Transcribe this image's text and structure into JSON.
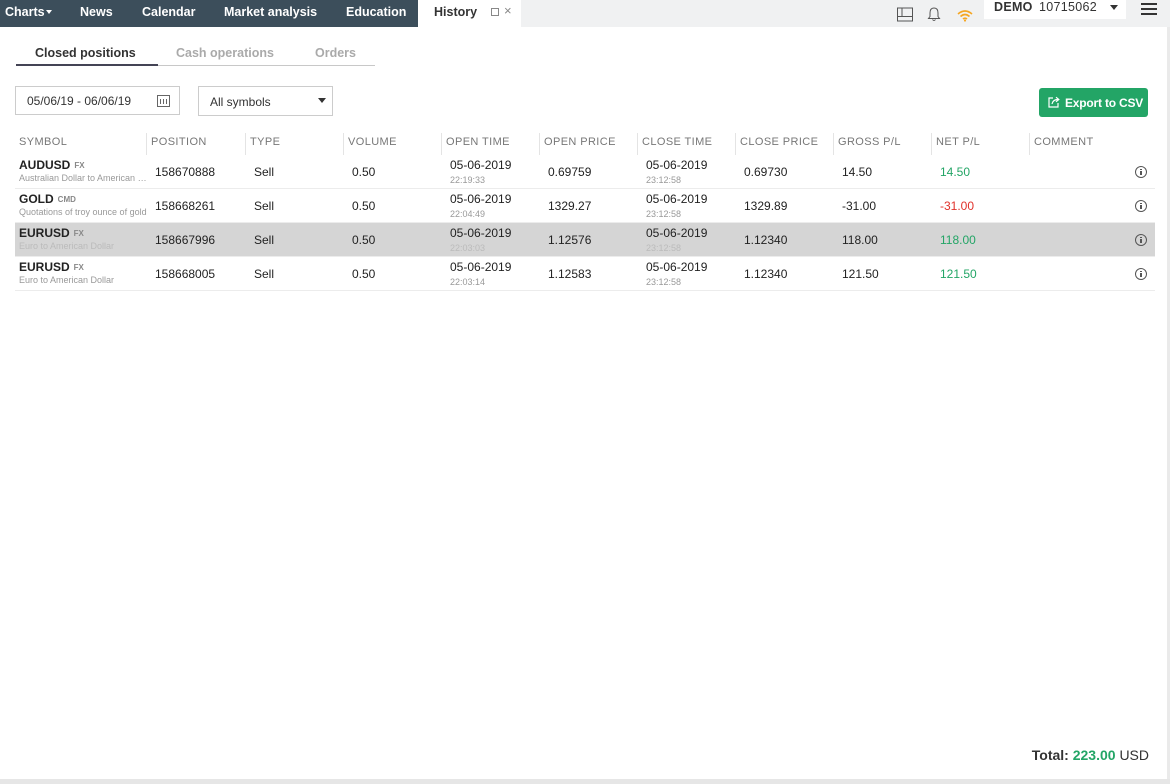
{
  "topnav": {
    "items": [
      "Charts",
      "News",
      "Calendar",
      "Market analysis",
      "Education"
    ],
    "active_tab": "History"
  },
  "account": {
    "mode": "DEMO",
    "number": "10715062"
  },
  "subtabs": [
    "Closed positions",
    "Cash operations",
    "Orders"
  ],
  "filters": {
    "date_range": "05/06/19 - 06/06/19",
    "symbols": "All symbols"
  },
  "export_label": "Export to CSV",
  "table": {
    "columns": [
      "SYMBOL",
      "POSITION",
      "TYPE",
      "VOLUME",
      "OPEN TIME",
      "OPEN PRICE",
      "CLOSE TIME",
      "CLOSE PRICE",
      "GROSS P/L",
      "NET P/L",
      "COMMENT"
    ],
    "rows": [
      {
        "symbol": "AUDUSD",
        "tag": "FX",
        "desc": "Australian Dollar to American Dollar",
        "position": "158670888",
        "type": "Sell",
        "volume": "0.50",
        "open_date": "05-06-2019",
        "open_time": "22:19:33",
        "open_price": "0.69759",
        "close_date": "05-06-2019",
        "close_time": "23:12:58",
        "close_price": "0.69730",
        "gross": "14.50",
        "net": "14.50",
        "net_sign": "pos",
        "comment": ""
      },
      {
        "symbol": "GOLD",
        "tag": "CMD",
        "desc": "Quotations of troy ounce of gold",
        "position": "158668261",
        "type": "Sell",
        "volume": "0.50",
        "open_date": "05-06-2019",
        "open_time": "22:04:49",
        "open_price": "1329.27",
        "close_date": "05-06-2019",
        "close_time": "23:12:58",
        "close_price": "1329.89",
        "gross": "-31.00",
        "net": "-31.00",
        "net_sign": "neg",
        "comment": ""
      },
      {
        "symbol": "EURUSD",
        "tag": "FX",
        "desc": "Euro to American Dollar",
        "position": "158667996",
        "type": "Sell",
        "volume": "0.50",
        "open_date": "05-06-2019",
        "open_time": "22:03:03",
        "open_price": "1.12576",
        "close_date": "05-06-2019",
        "close_time": "23:12:58",
        "close_price": "1.12340",
        "gross": "118.00",
        "net": "118.00",
        "net_sign": "pos",
        "comment": "",
        "selected": true
      },
      {
        "symbol": "EURUSD",
        "tag": "FX",
        "desc": "Euro to American Dollar",
        "position": "158668005",
        "type": "Sell",
        "volume": "0.50",
        "open_date": "05-06-2019",
        "open_time": "22:03:14",
        "open_price": "1.12583",
        "close_date": "05-06-2019",
        "close_time": "23:12:58",
        "close_price": "1.12340",
        "gross": "121.50",
        "net": "121.50",
        "net_sign": "pos",
        "comment": ""
      }
    ]
  },
  "total": {
    "label": "Total:",
    "amount": "223.00",
    "currency": "USD"
  },
  "colors": {
    "nav_bg": "#3c4e5b",
    "accent_green": "#23a566",
    "negative_red": "#e0312a"
  },
  "icons": [
    "layout-icon",
    "bell-icon",
    "signal-icon",
    "calendar-icon",
    "export-icon",
    "info-icon",
    "menu-icon"
  ]
}
